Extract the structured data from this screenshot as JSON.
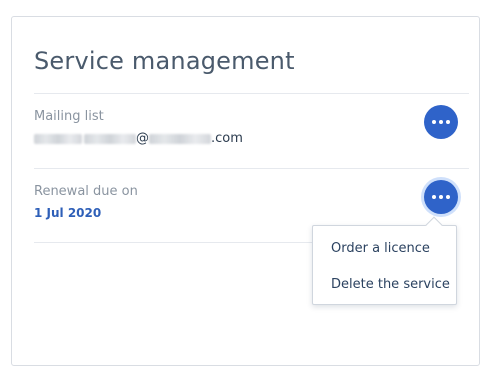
{
  "panel": {
    "title": "Service management"
  },
  "mailing_list": {
    "label": "Mailing list",
    "email_domain_suffix": ".com",
    "at_sign": "@"
  },
  "renewal": {
    "label": "Renewal due on",
    "date": "1 Jul 2020"
  },
  "actions_menu": {
    "items": [
      "Order a licence",
      "Delete the service"
    ]
  },
  "colors": {
    "accent": "#2f63c9",
    "title": "#4a5a6c",
    "date": "#2e5fb8"
  },
  "icons": {
    "action_button": "more-horizontal-icon"
  }
}
